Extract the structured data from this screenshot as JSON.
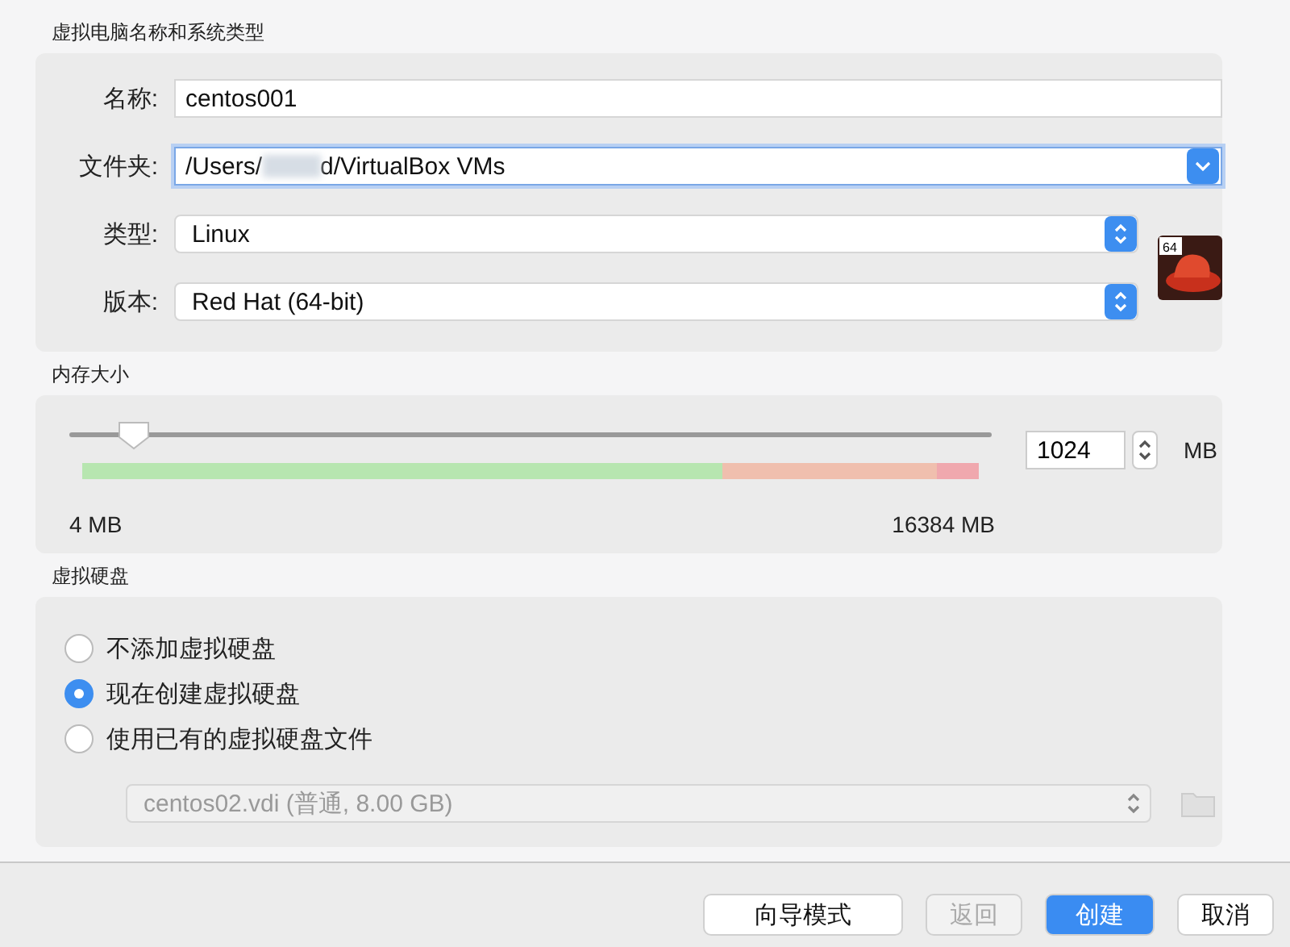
{
  "name_section": {
    "title": "虚拟电脑名称和系统类型",
    "name": {
      "label": "名称:",
      "value": "centos001"
    },
    "folder": {
      "label": "文件夹:",
      "value_start": "/Users/",
      "value_end": "d/VirtualBox VMs",
      "focused": true
    },
    "type": {
      "label": "类型:",
      "value": "Linux"
    },
    "version": {
      "label": "版本:",
      "value": "Red Hat (64-bit)"
    },
    "os_badge": "64"
  },
  "memory": {
    "title": "内存大小",
    "level": 0.07,
    "value": "1024",
    "unit": "MB",
    "min_label": "4 MB",
    "max_label": "16384 MB"
  },
  "disk": {
    "title": "虚拟硬盘",
    "options": [
      {
        "label": "不添加虚拟硬盘",
        "selected": false
      },
      {
        "label": "现在创建虚拟硬盘",
        "selected": true
      },
      {
        "label": "使用已有的虚拟硬盘文件",
        "selected": false
      }
    ],
    "file": {
      "value": "centos02.vdi (普通, 8.00 GB)",
      "disabled": true
    }
  },
  "buttons": [
    {
      "label": "向导模式",
      "kind": "normal",
      "disabled": false
    },
    {
      "label": "返回",
      "kind": "normal",
      "disabled": true
    },
    {
      "label": "创建",
      "kind": "default",
      "disabled": false
    },
    {
      "label": "取消",
      "kind": "normal",
      "disabled": false
    }
  ]
}
